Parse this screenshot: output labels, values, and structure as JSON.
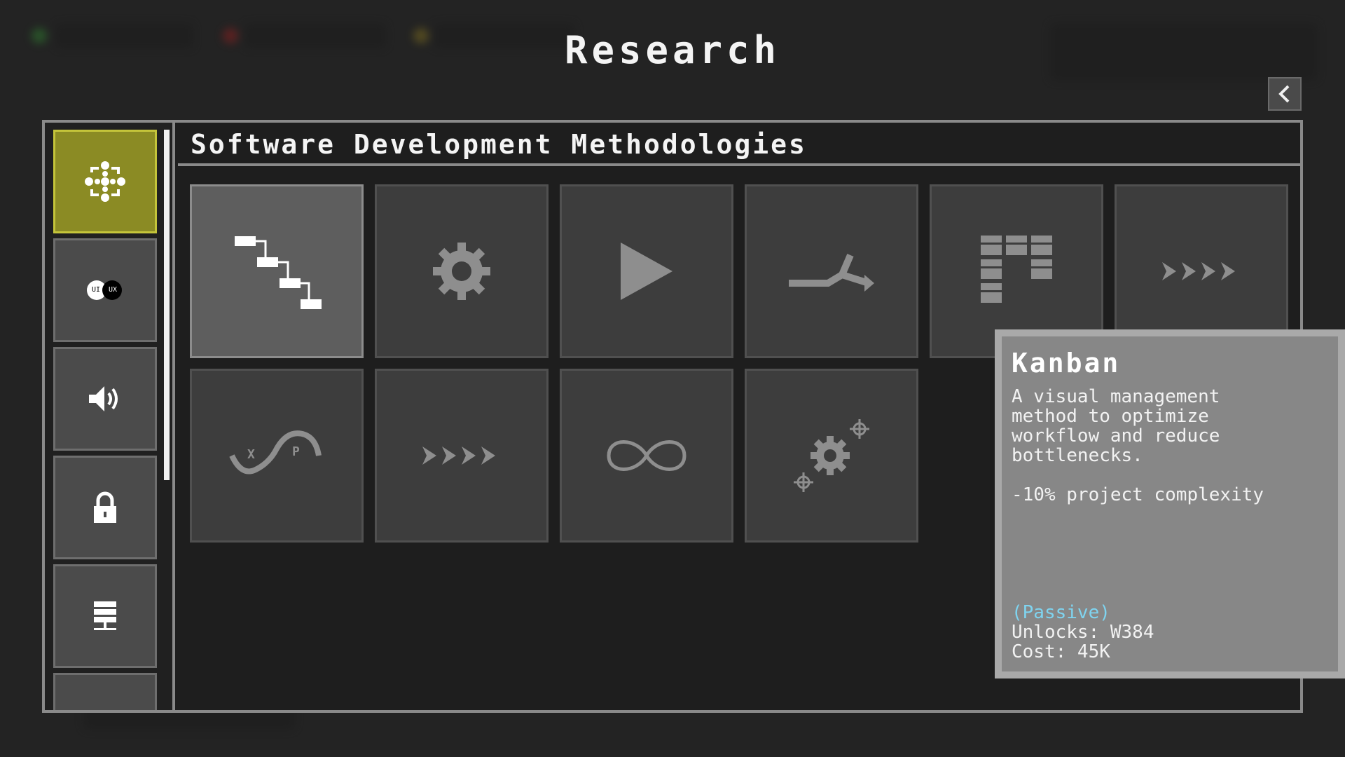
{
  "screen": {
    "title": "Research",
    "back_button_icon": "chevron-left-icon"
  },
  "category_panel": {
    "title": "Software Development Methodologies"
  },
  "categories": [
    {
      "icon": "process-cycle-icon",
      "label": "",
      "active": true
    },
    {
      "icon": "ui-ux-icon",
      "ui": "UI",
      "ux": "UX",
      "active": false
    },
    {
      "icon": "speaker-icon",
      "label": "",
      "active": false
    },
    {
      "icon": "lock-icon",
      "label": "",
      "active": false
    },
    {
      "icon": "server-icon",
      "label": "",
      "active": false
    },
    {
      "icon": "unknown-icon",
      "label": "",
      "active": false
    }
  ],
  "research_items": [
    {
      "icon": "waterfall-icon",
      "selected": true
    },
    {
      "icon": "gear-icon",
      "selected": false
    },
    {
      "icon": "play-icon",
      "selected": false
    },
    {
      "icon": "merge-arrow-icon",
      "selected": false
    },
    {
      "icon": "kanban-board-icon",
      "selected": false
    },
    {
      "icon": "chevrons-right-icon",
      "selected": false
    },
    {
      "icon": "xp-wave-icon",
      "x_label": "X",
      "p_label": "P",
      "selected": false
    },
    {
      "icon": "chevrons-right-icon",
      "selected": false
    },
    {
      "icon": "infinity-icon",
      "selected": false
    },
    {
      "icon": "gears-icon",
      "selected": false
    }
  ],
  "tooltip": {
    "title": "Kanban",
    "description": "A visual management method to optimize workflow and reduce bottlenecks.",
    "effect": "-10% project complexity",
    "type": "(Passive)",
    "unlocks": "Unlocks: W384",
    "cost": "Cost: 45K"
  },
  "colors": {
    "active_category": "#8b8b24",
    "passive_text": "#7fd4f0",
    "panel_border": "#8a8a8a"
  }
}
